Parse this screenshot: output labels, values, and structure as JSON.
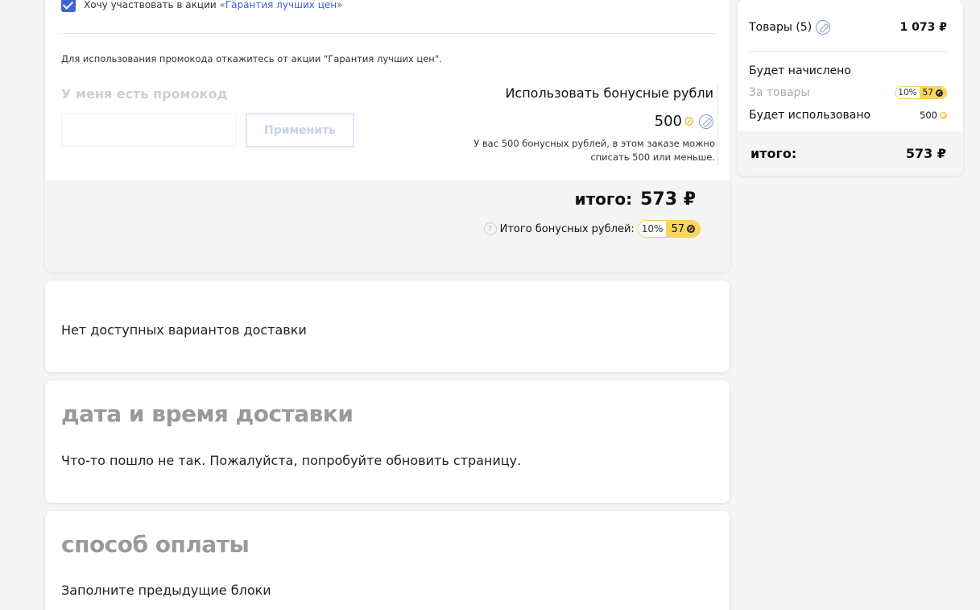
{
  "promo": {
    "checkbox_label": "Хочу участвовать в акции ",
    "checkbox_link": "«Гарантия лучших цен»",
    "note": "Для использования промокода откажитесь от акции \"Гарантия лучших цен\".",
    "promo_title": "У меня есть промокод",
    "apply_label": "Применить",
    "bonus_title": "Использовать бонусные рубли",
    "bonus_amount": "500",
    "bonus_desc_line1": "У вас 500 бонусных рублей, в этом заказе можно",
    "bonus_desc_line2": "списать 500 или меньше.",
    "total_label": "итого:",
    "total_value": "573 ₽",
    "bonus_total_label": "Итого бонусных рублей:",
    "bonus_pct": "10%",
    "bonus_value": "57"
  },
  "delivery": {
    "message": "Нет доступных вариантов доставки"
  },
  "date_section": {
    "title": "дата и время доставки",
    "message": "Что-то пошло не так. Пожалуйста, попробуйте обновить страницу."
  },
  "payment_section": {
    "title": "способ оплаты",
    "message": "Заполните предыдущие блоки"
  },
  "summary": {
    "goods_label": "Товары (5)",
    "goods_price": "1 073 ₽",
    "accrue_label": "Будет начислено",
    "for_goods_label": "За товары",
    "for_goods_pct": "10%",
    "for_goods_value": "57",
    "used_label": "Будет использовано",
    "used_value": "500",
    "total_label": "итого:",
    "total_value": "573 ₽"
  },
  "colors": {
    "accent": "#3d63d6",
    "bonus_yellow": "#fad55c"
  }
}
